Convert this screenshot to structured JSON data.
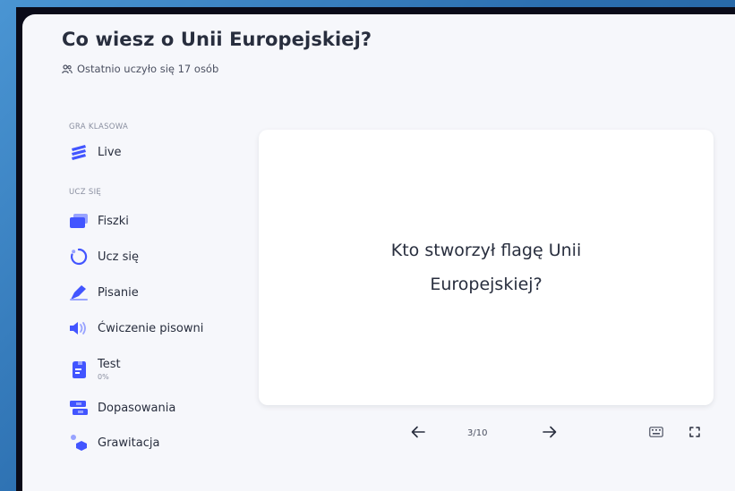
{
  "header": {
    "title": "Co wiesz o Unii Europejskiej?",
    "subtitle": "Ostatnio uczyło się 17 osób",
    "subtitle_icon": "users-icon"
  },
  "sidebar": {
    "sections": [
      {
        "label": "GRA KLASOWA",
        "items": [
          {
            "label": "Live",
            "icon": "live-icon"
          }
        ]
      },
      {
        "label": "UCZ SIĘ",
        "items": [
          {
            "label": "Fiszki",
            "icon": "flashcards-icon"
          },
          {
            "label": "Ucz się",
            "icon": "learn-icon"
          },
          {
            "label": "Pisanie",
            "icon": "write-icon"
          },
          {
            "label": "Ćwiczenie pisowni",
            "icon": "spell-icon"
          },
          {
            "label": "Test",
            "sublabel": "0%",
            "icon": "test-icon"
          },
          {
            "label": "Dopasowania",
            "icon": "match-icon"
          },
          {
            "label": "Grawitacja",
            "icon": "gravity-icon"
          }
        ]
      }
    ]
  },
  "card": {
    "text": "Kto stworzył flagę Unii Europejskiej?"
  },
  "controls": {
    "counter": "3/10",
    "prev_icon": "arrow-left-icon",
    "next_icon": "arrow-right-icon",
    "keyboard_icon": "keyboard-icon",
    "fullscreen_icon": "fullscreen-icon"
  },
  "colors": {
    "accent": "#4255ff",
    "text": "#282e3e",
    "muted": "#8a8fa0",
    "panel": "#f6f7fb"
  }
}
